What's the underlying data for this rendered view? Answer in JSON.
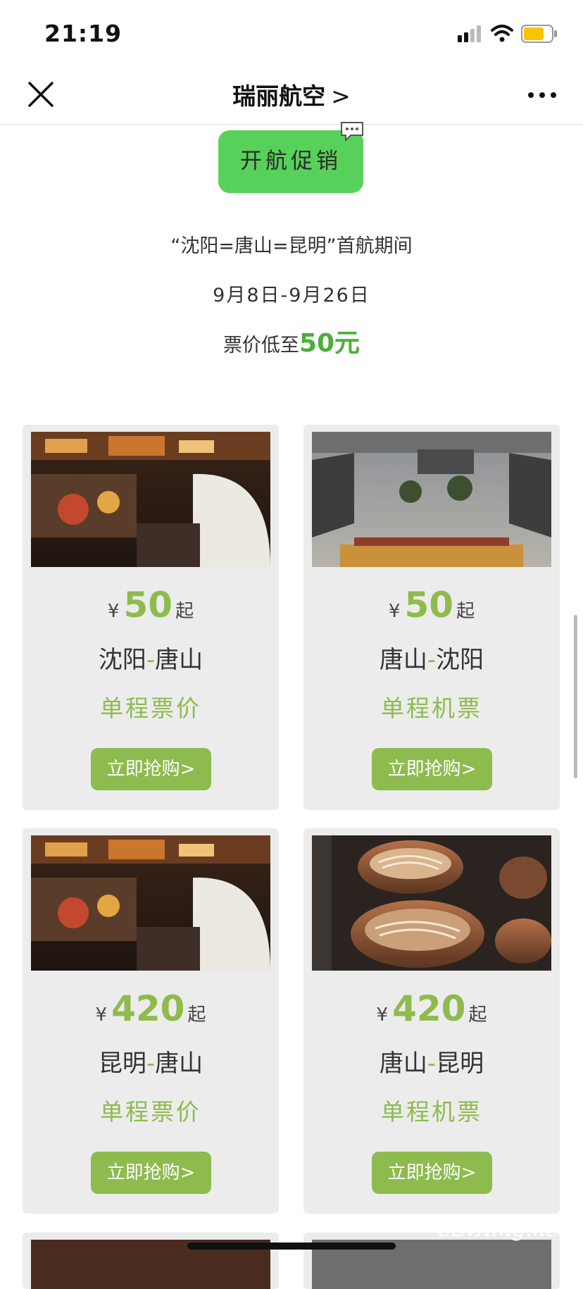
{
  "status_bar": {
    "time": "21:19"
  },
  "nav": {
    "title": "瑞丽航空",
    "chevron": ">"
  },
  "promo": {
    "badge": "开航促销",
    "line1": "“沈阳=唐山=昆明”首航期间",
    "line2": "9月8日-9月26日",
    "line3_prefix": "票价低至",
    "line3_price": "50元"
  },
  "cards": [
    {
      "currency": "¥",
      "price": "50",
      "suffix": "起",
      "from": "沈阳",
      "dash": "-",
      "to": "唐山",
      "ticket_type": "单程票价",
      "button": "立即抢购>",
      "photo": "night-street-photo"
    },
    {
      "currency": "¥",
      "price": "50",
      "suffix": "起",
      "from": "唐山",
      "dash": "-",
      "to": "沈阳",
      "ticket_type": "单程机票",
      "button": "立即抢购>",
      "photo": "temple-courtyard-photo"
    },
    {
      "currency": "¥",
      "price": "420",
      "suffix": "起",
      "from": "昆明",
      "dash": "-",
      "to": "唐山",
      "ticket_type": "单程票价",
      "button": "立即抢购>",
      "photo": "night-street-photo"
    },
    {
      "currency": "¥",
      "price": "420",
      "suffix": "起",
      "from": "唐山",
      "dash": "-",
      "to": "昆明",
      "ticket_type": "单程机票",
      "button": "立即抢购>",
      "photo": "noodle-bowls-photo"
    }
  ],
  "watermark": "eLvXing.net",
  "colors": {
    "accent_green": "#8dbb4e",
    "promo_green": "#58d15a",
    "card_bg": "#ececec"
  }
}
